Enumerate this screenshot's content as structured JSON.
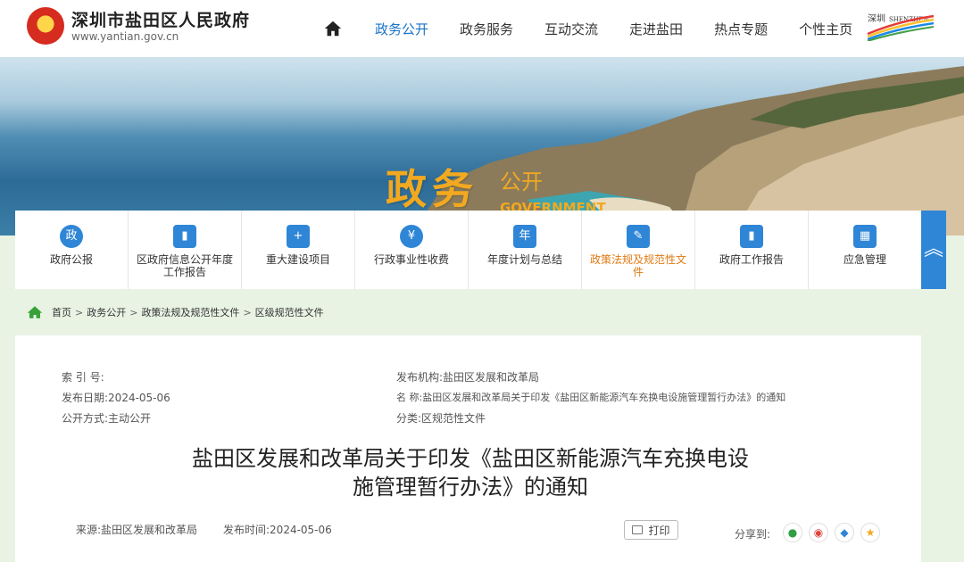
{
  "header": {
    "site_title": "深圳市盐田区人民政府",
    "site_url": "www.yantian.gov.cn",
    "nav": [
      "政务公开",
      "政务服务",
      "互动交流",
      "走进盐田",
      "热点专题",
      "个性主页"
    ],
    "active_nav": "政务公开",
    "logo_text": "深圳 SHENZHEN CHINA"
  },
  "banner": {
    "title": "政务",
    "subtitle": "公开",
    "english": "GOVERNMENT"
  },
  "categories": [
    {
      "label": "政府公报",
      "icon": "政"
    },
    {
      "label": "区政府信息公开年度工作报告",
      "icon": "▮"
    },
    {
      "label": "重大建设项目",
      "icon": "+"
    },
    {
      "label": "行政事业性收费",
      "icon": "¥"
    },
    {
      "label": "年度计划与总结",
      "icon": "年"
    },
    {
      "label": "政策法规及规范性文件",
      "icon": "✎",
      "active": true
    },
    {
      "label": "政府工作报告",
      "icon": "▮"
    },
    {
      "label": "应急管理",
      "icon": "▦"
    }
  ],
  "breadcrumb": [
    "首页",
    "政务公开",
    "政策法规及规范性文件",
    "区级规范性文件"
  ],
  "meta": {
    "index_label": "索 引 号:",
    "index_value": "",
    "date_label": "发布日期:",
    "date_value": "2024-05-06",
    "mode_label": "公开方式:",
    "mode_value": "主动公开",
    "org_label": "发布机构:",
    "org_value": "盐田区发展和改革局",
    "name_label": "名  称:",
    "name_value": "盐田区发展和改革局关于印发《盐田区新能源汽车充换电设施管理暂行办法》的通知",
    "class_label": "分类:",
    "class_value": "区规范性文件"
  },
  "document": {
    "title_line1": "盐田区发展和改革局关于印发《盐田区新能源汽车充换电设",
    "title_line2": "施管理暂行办法》的通知",
    "source": "来源:盐田区发展和改革局",
    "publish_time": "发布时间:2024-05-06",
    "print_label": "打印",
    "share_label": "分享到:"
  },
  "colors": {
    "accent": "#2f86d6",
    "active_nav": "#1a73c8",
    "banner_title": "#f2a91f",
    "active_category": "#e07a12"
  }
}
